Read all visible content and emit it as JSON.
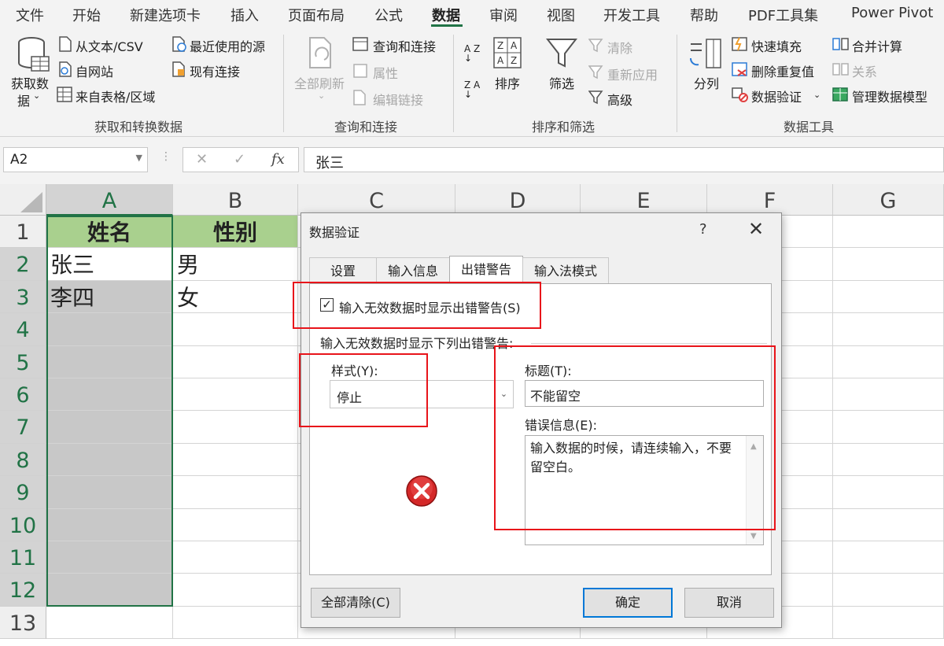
{
  "menu": {
    "items": [
      "文件",
      "开始",
      "新建选项卡",
      "插入",
      "页面布局",
      "公式",
      "数据",
      "审阅",
      "视图",
      "开发工具",
      "帮助",
      "PDF工具集",
      "Power Pivot"
    ],
    "active": "数据"
  },
  "ribbon": {
    "get_data_line1": "获取数",
    "get_data_line2": "据",
    "from_text": "从文本/CSV",
    "from_web": "自网站",
    "from_table": "来自表格/区域",
    "recent_sources": "最近使用的源",
    "existing_conn": "现有连接",
    "group_get": "获取和转换数据",
    "refresh_all": "全部刷新",
    "queries_conn": "查询和连接",
    "properties": "属性",
    "edit_links": "编辑链接",
    "group_query": "查询和连接",
    "sort": "排序",
    "filter": "筛选",
    "clear": "清除",
    "reapply": "重新应用",
    "advanced": "高级",
    "group_sort": "排序和筛选",
    "split": "分列",
    "flash_fill": "快速填充",
    "remove_dup": "删除重复值",
    "data_validation": "数据验证",
    "consolidate": "合并计算",
    "relations": "关系",
    "data_model": "管理数据模型",
    "group_tools": "数据工具",
    "sort_az": "A Z",
    "sort_za": "Z A"
  },
  "formula_bar": {
    "name_box": "A2",
    "content": "张三",
    "cancel": "✕",
    "enter": "✓",
    "fx": "fx"
  },
  "sheet": {
    "columns": [
      "A",
      "B",
      "C",
      "D",
      "E",
      "F",
      "G"
    ],
    "rows": [
      "1",
      "2",
      "3",
      "4",
      "5",
      "6",
      "7",
      "8",
      "9",
      "10",
      "11",
      "12",
      "13"
    ],
    "cells": {
      "A1": "姓名",
      "B1": "性别",
      "A2": "张三",
      "B2": "男",
      "A3": "李四",
      "B3": "女"
    }
  },
  "dialog": {
    "title": "数据验证",
    "help": "?",
    "close": "✕",
    "tabs": [
      "设置",
      "输入信息",
      "出错警告",
      "输入法模式"
    ],
    "active_tab": "出错警告",
    "show_error_alert": "输入无效数据时显示出错警告(S)",
    "show_error_checked": true,
    "desc": "输入无效数据时显示下列出错警告:",
    "style_label": "样式(Y):",
    "style_value": "停止",
    "title_label": "标题(T):",
    "title_value": "不能留空",
    "error_msg_label": "错误信息(E):",
    "error_msg_value": "输入数据的时候，请连续输入，不要留空白。",
    "clear_all": "全部清除(C)",
    "ok": "确定",
    "cancel": "取消"
  },
  "colors": {
    "excel_green": "#217346",
    "header_fill": "#a9d08e",
    "highlight_red": "#e8141a",
    "selected_gray": "#c8c8c8"
  }
}
